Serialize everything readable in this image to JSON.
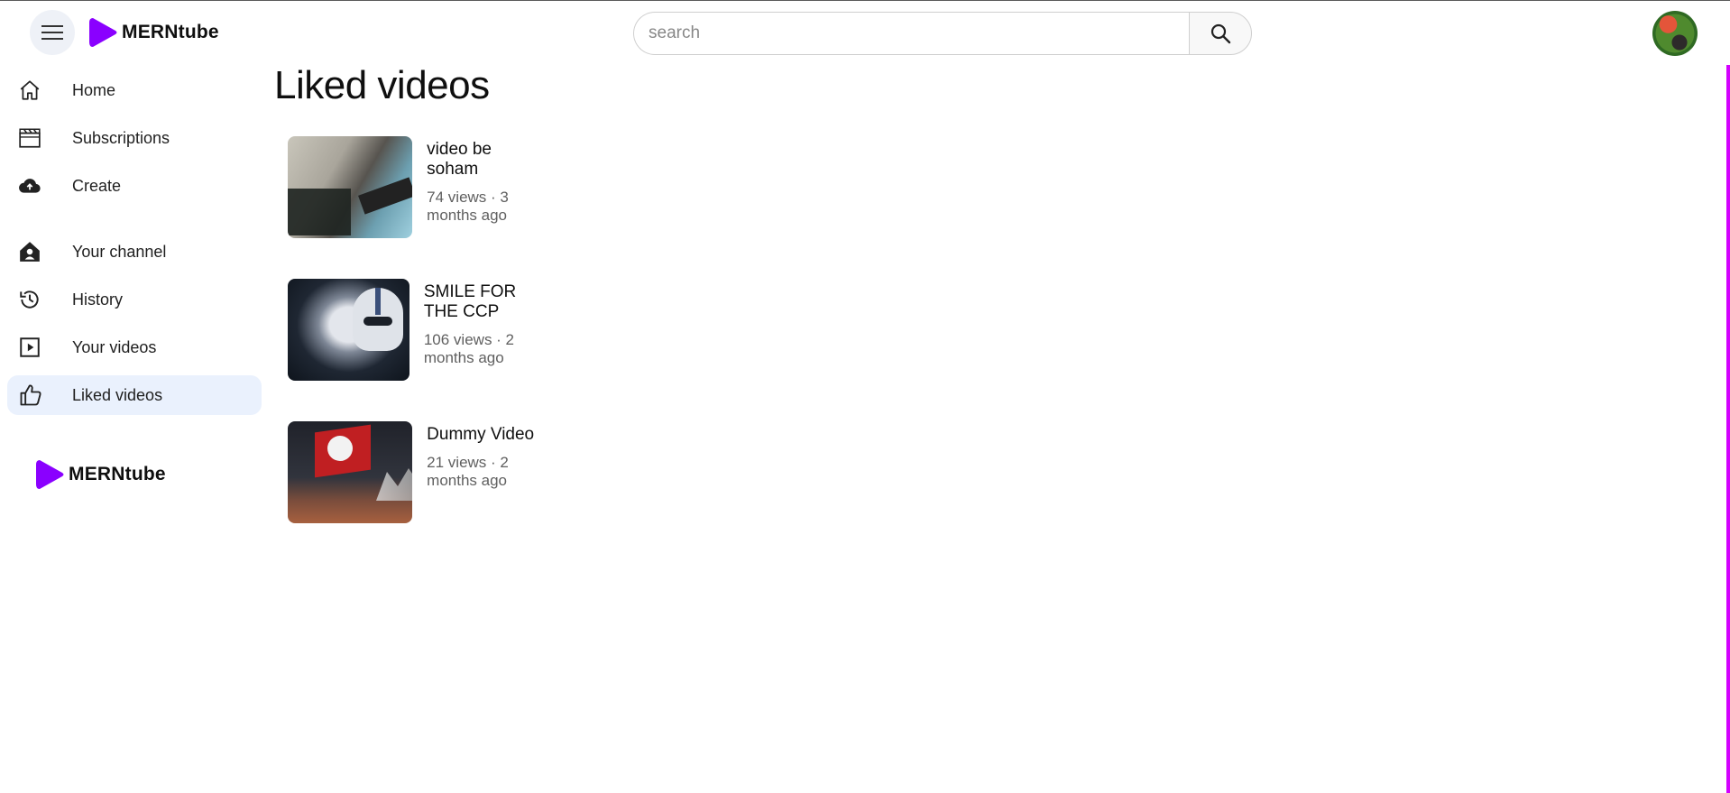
{
  "app": {
    "brand": "MERNtube"
  },
  "search": {
    "placeholder": "search"
  },
  "sidebar": {
    "items": [
      {
        "label": "Home",
        "icon": "home-icon"
      },
      {
        "label": "Subscriptions",
        "icon": "subscriptions-icon"
      },
      {
        "label": "Create",
        "icon": "upload-cloud-icon"
      },
      {
        "label": "Your channel",
        "icon": "channel-icon"
      },
      {
        "label": "History",
        "icon": "history-icon"
      },
      {
        "label": "Your videos",
        "icon": "your-videos-icon"
      },
      {
        "label": "Liked videos",
        "icon": "thumbs-up-icon",
        "active": true
      }
    ]
  },
  "main": {
    "title": "Liked videos",
    "videos": [
      {
        "title": "video be soham",
        "subtitle": "74 views · 3 months ago"
      },
      {
        "title": "SMILE FOR THE CCP",
        "subtitle": "106 views · 2 months ago"
      },
      {
        "title": "Dummy Video",
        "subtitle": "21 views · 2 months ago"
      }
    ]
  },
  "colors": {
    "brand": "#8a00ff",
    "active_bg": "#eaf1fd",
    "scrollbar": "#d300ff"
  }
}
